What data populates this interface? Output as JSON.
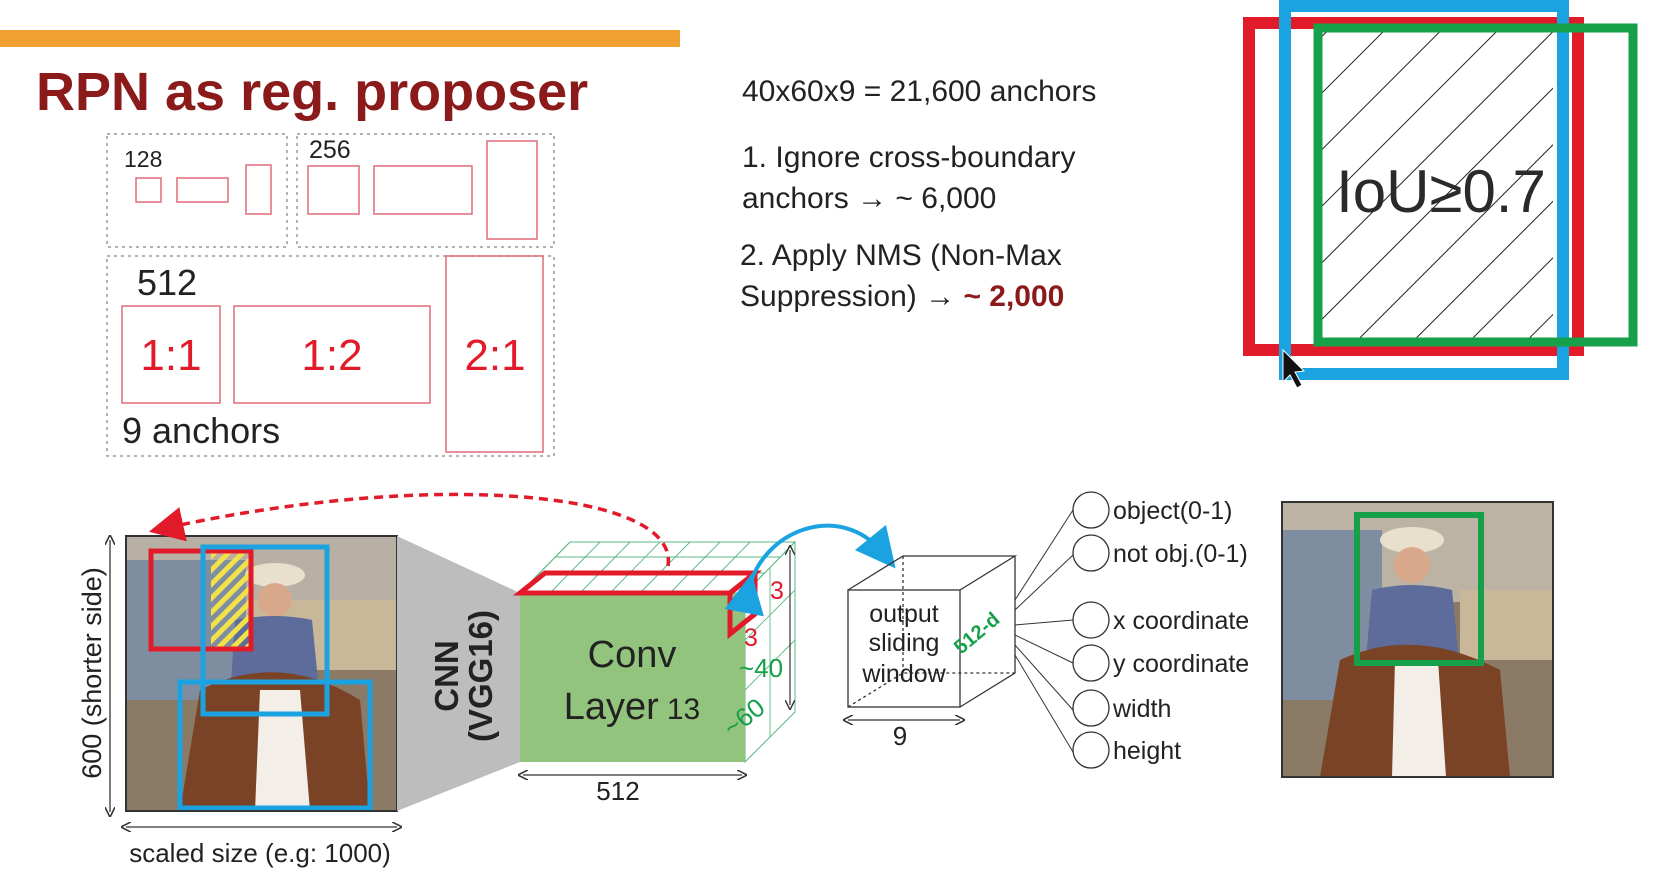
{
  "slide": {
    "title": "RPN as reg. proposer",
    "colors": {
      "title": "#8b1a1a",
      "accent_bar": "#f0a030",
      "red": "#e21b2b",
      "blue": "#1aa3e0",
      "green": "#16a04a",
      "conv_fill": "#93c47d"
    }
  },
  "anchors": {
    "size_128": "128",
    "size_256": "256",
    "size_512": "512",
    "ratio_1_1": "1:1",
    "ratio_1_2": "1:2",
    "ratio_2_1": "2:1",
    "count_label": "9 anchors"
  },
  "steps": {
    "total": "40x60x9 = 21,600 anchors",
    "step1_line1": "1. Ignore cross-boundary",
    "step1_line2": "anchors → ~ 6,000",
    "step2_line1": "2. Apply NMS (Non-Max",
    "step2_line2_prefix": "Suppression) → ",
    "step2_line2_value": "~ 2,000"
  },
  "iou": {
    "label": "IoU≥0.7"
  },
  "pipeline": {
    "input_height": "600 (shorter side)",
    "input_width": "scaled size (e.g: 1000)",
    "cnn_line1": "CNN",
    "cnn_line2": "(VGG16)",
    "conv_line1": "Conv",
    "conv_line2": "Layer",
    "conv_num": "13",
    "conv_width": "512",
    "kernel_w": "3",
    "kernel_h": "3",
    "feat_h": "~40",
    "feat_w": "~60",
    "window_line1": "output",
    "window_line2": "sliding",
    "window_line3": "window",
    "window_depth": "512-d",
    "window_size": "9",
    "outputs": [
      "object(0-1)",
      "not obj.(0-1)",
      "x coordinate",
      "y coordinate",
      "width",
      "height"
    ]
  }
}
